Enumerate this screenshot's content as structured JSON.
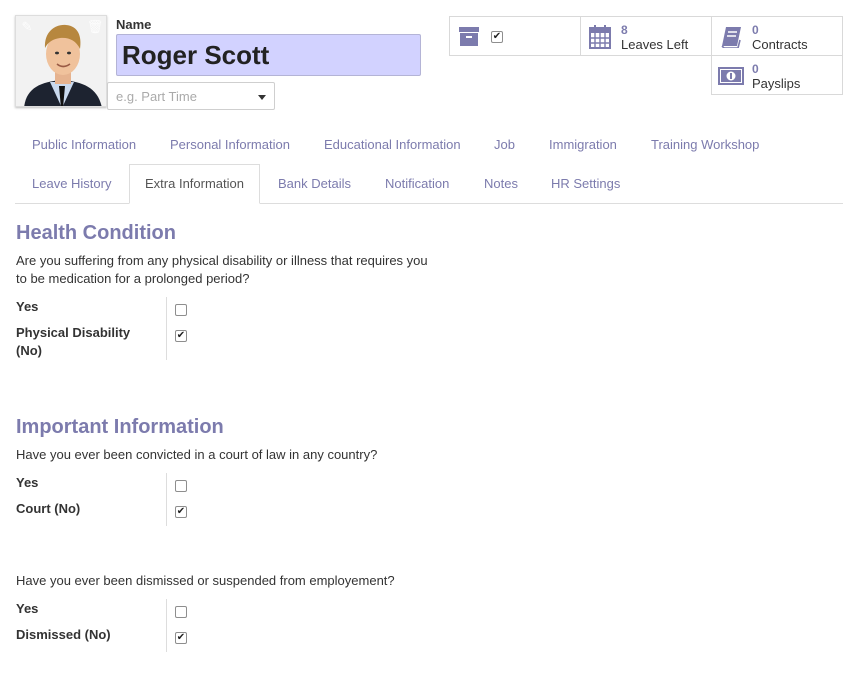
{
  "employee": {
    "name_label": "Name",
    "name": "Roger Scott",
    "job_placeholder": "e.g. Part Time"
  },
  "smart_buttons": {
    "active_checked": true,
    "leaves": {
      "count": "8",
      "label": "Leaves Left"
    },
    "contracts": {
      "count": "0",
      "label": "Contracts"
    },
    "payslips": {
      "count": "0",
      "label": "Payslips"
    }
  },
  "tabs": {
    "row1": [
      "Public Information",
      "Personal Information",
      "Educational Information",
      "Job",
      "Immigration",
      "Training Workshop"
    ],
    "row2": [
      "Leave History",
      "Extra Information",
      "Bank Details",
      "Notification",
      "Notes",
      "HR Settings"
    ],
    "active": "Extra Information"
  },
  "health": {
    "title": "Health Condition",
    "question_line1": "Are you suffering from any physical disability or illness that requires you",
    "question_line2": "to be medication for a prolonged period?",
    "yes_label": "Yes",
    "yes_checked": false,
    "no_label_line1": "Physical Disability",
    "no_label_line2": "(No)",
    "no_checked": true
  },
  "important": {
    "title": "Important Information",
    "court_question": "Have you ever been convicted in a court of law in any country?",
    "court_yes_label": "Yes",
    "court_yes_checked": false,
    "court_no_label": "Court (No)",
    "court_no_checked": true,
    "dismiss_question": "Have you ever been dismissed or suspended from employement?",
    "dismiss_yes_label": "Yes",
    "dismiss_yes_checked": false,
    "dismiss_no_label": "Dismissed (No)",
    "dismiss_no_checked": true
  },
  "colors": {
    "accent": "#7c7bad",
    "name_field_bg": "#d2d2ff"
  }
}
